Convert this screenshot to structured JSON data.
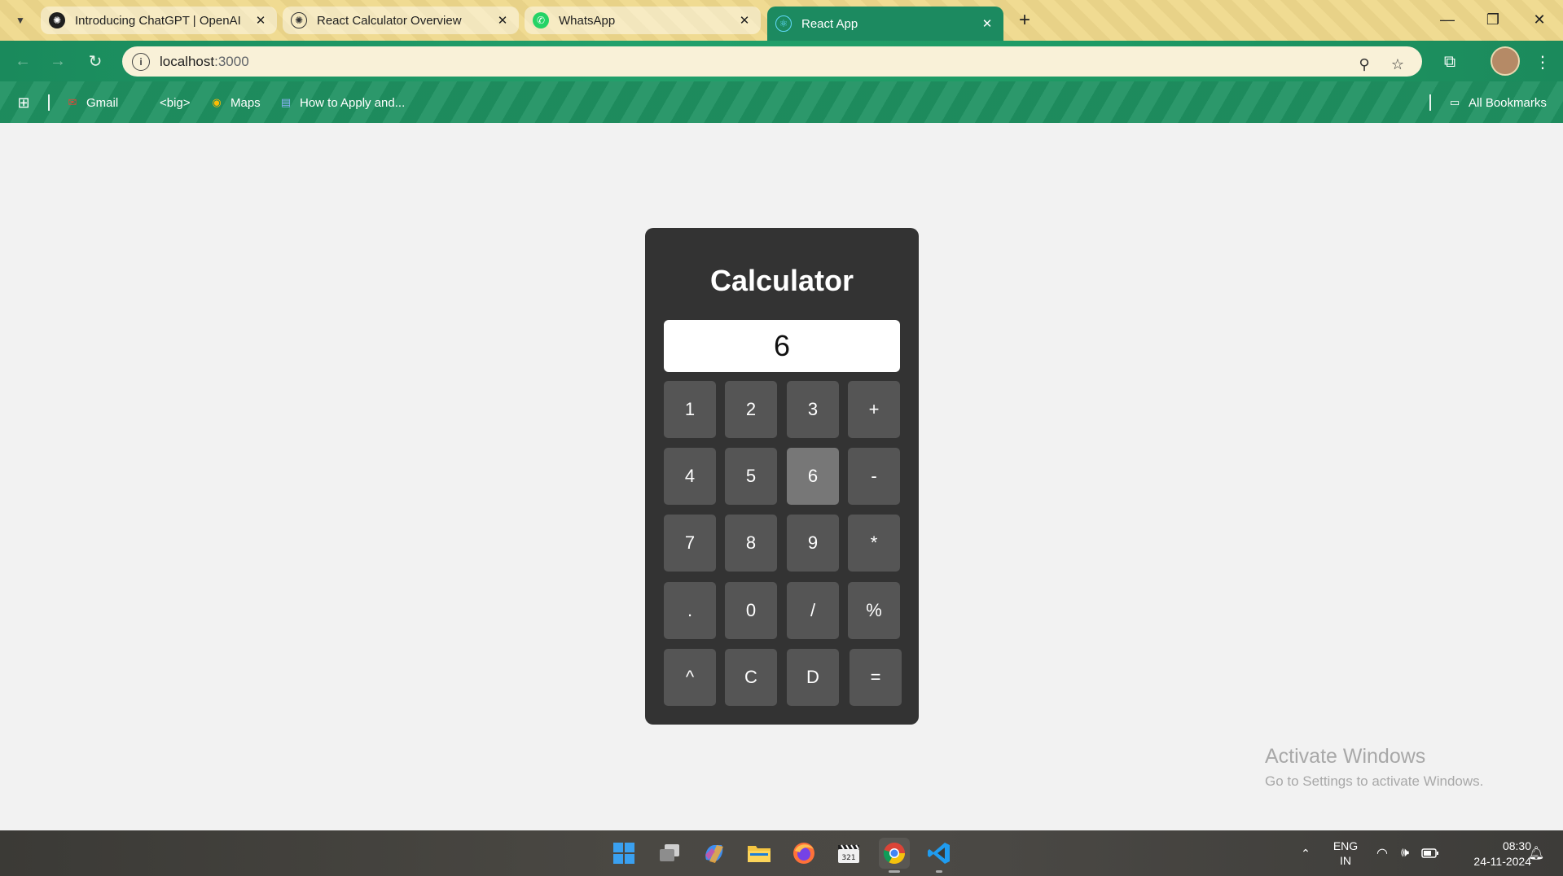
{
  "browser": {
    "tabs": [
      {
        "title": "Introducing ChatGPT | OpenAI",
        "icon": "openai-icon"
      },
      {
        "title": "React Calculator Overview",
        "icon": "openai-icon"
      },
      {
        "title": "WhatsApp",
        "icon": "whatsapp-icon"
      },
      {
        "title": "React App",
        "icon": "react-icon",
        "active": true
      }
    ],
    "url_host": "localhost",
    "url_port": ":3000",
    "bookmarks": [
      {
        "label": "Gmail",
        "icon": "gmail-icon"
      },
      {
        "label": "<big>",
        "icon": "bookmark-icon"
      },
      {
        "label": "Maps",
        "icon": "maps-icon"
      },
      {
        "label": "How to Apply and...",
        "icon": "page-icon"
      }
    ],
    "all_bookmarks": "All Bookmarks"
  },
  "calculator": {
    "title": "Calculator",
    "display": "6",
    "pressed_key": "6",
    "keys": [
      [
        "1",
        "2",
        "3",
        "+"
      ],
      [
        "4",
        "5",
        "6",
        "-"
      ],
      [
        "7",
        "8",
        "9",
        "*"
      ],
      [
        ".",
        "0",
        "/",
        "%"
      ],
      [
        "^",
        "C",
        "D",
        "="
      ]
    ]
  },
  "watermark": {
    "line1": "Activate Windows",
    "line2": "Go to Settings to activate Windows."
  },
  "taskbar": {
    "apps": [
      "windows-start-icon",
      "task-view-icon",
      "copilot-icon",
      "file-explorer-icon",
      "firefox-icon",
      "clapper-icon",
      "chrome-icon",
      "vscode-icon"
    ],
    "lang_line1": "ENG",
    "lang_line2": "IN",
    "time": "08:30",
    "date": "24-11-2024"
  },
  "colors": {
    "calc_bg": "#333333",
    "key_bg": "#555555",
    "key_pressed_bg": "#777777",
    "tab_active": "#1c8a60",
    "toolbar_green": "#1f9262"
  }
}
